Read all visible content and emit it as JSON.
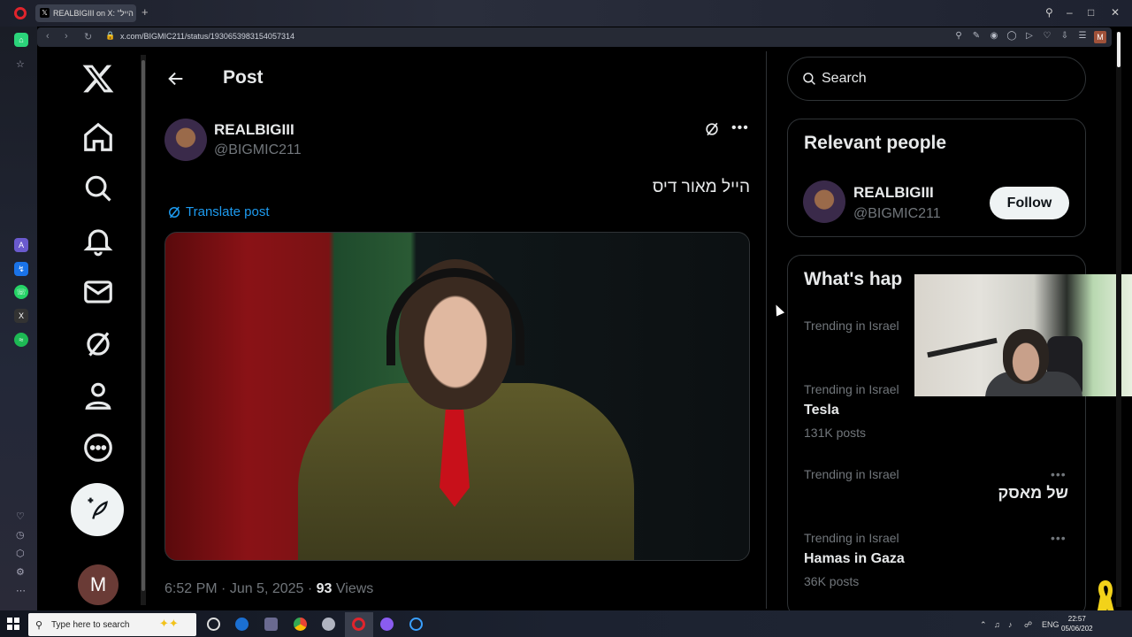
{
  "browser": {
    "tab_title": "REALBIGIII on X: \"הייל",
    "url": "x.com/BIGMIC211/status/1930653983154057314",
    "profile_initial": "M"
  },
  "header": {
    "title": "Post"
  },
  "post": {
    "author_name": "REALBIGIII",
    "author_handle": "@BIGMIC211",
    "text": "הייל מאור דיס",
    "translate_label": "Translate post",
    "time": "6:52 PM",
    "sep": " · ",
    "date": "Jun 5, 2025",
    "views": "93",
    "views_label": "Views"
  },
  "sidebar": {
    "me_initial": "M"
  },
  "search": {
    "placeholder": "Search"
  },
  "relevant": {
    "title": "Relevant people",
    "name": "REALBIGIII",
    "handle": "@BIGMIC211",
    "follow_label": "Follow"
  },
  "whats_happening": {
    "title": "What's hap",
    "trends": [
      {
        "meta": "Trending in Israel",
        "name": "",
        "count": ""
      },
      {
        "meta": "Trending in Israel",
        "name": "Tesla",
        "count": "131K posts"
      },
      {
        "meta": "Trending in Israel",
        "name": "של מאסק",
        "count": ""
      },
      {
        "meta": "Trending in Israel",
        "name": "Hamas in Gaza",
        "count": "36K posts"
      }
    ]
  },
  "taskbar": {
    "search_placeholder": "Type here to search",
    "lang": "ENG",
    "time": "22:57",
    "date": "05/06/202"
  },
  "colors": {
    "accent": "#1d9bf0",
    "background": "#000000",
    "secondary_text": "#71767b"
  }
}
